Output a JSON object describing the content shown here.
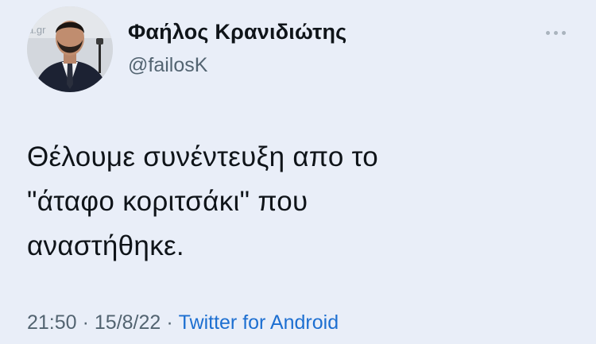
{
  "author": {
    "name": "Φαήλος Κρανιδιώτης",
    "handle": "@failosK",
    "avatar_watermark": "a.gr"
  },
  "tweet": {
    "lines": [
      "Θέλουμε συνέντευξη απο το",
      "\"άταφο κοριτσάκι\" που",
      "αναστήθηκε."
    ]
  },
  "meta": {
    "time": "21:50",
    "date": "15/8/22",
    "separator": "·",
    "source": "Twitter for Android"
  },
  "colors": {
    "background": "#e9eef8",
    "text": "#0f1419",
    "secondary": "#536471",
    "link": "#1d6fd1"
  },
  "icons": {
    "more": "more-dots-icon"
  }
}
